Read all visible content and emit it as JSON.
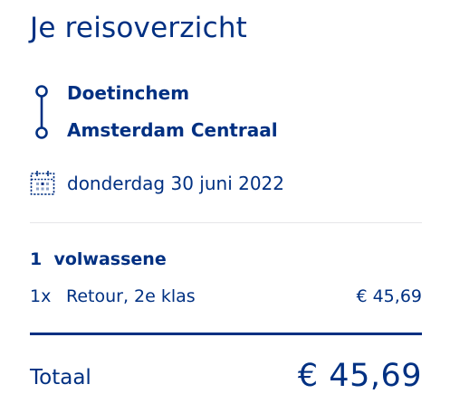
{
  "summary": {
    "title": "Je reisoverzicht"
  },
  "route": {
    "from": "Doetinchem",
    "to": "Amsterdam Centraal",
    "icon": "route-line-icon"
  },
  "travel_date": {
    "icon": "calendar-icon",
    "text": "donderdag 30 juni 2022"
  },
  "passengers": {
    "count": "1",
    "type": "volwassene"
  },
  "tickets": [
    {
      "qty": "1x",
      "description": "Retour, 2e klas",
      "price": "€  45,69"
    }
  ],
  "total": {
    "label": "Totaal",
    "amount": "€  45,69"
  },
  "colors": {
    "brand_blue": "#003082",
    "divider_light": "#e6e6e9"
  }
}
